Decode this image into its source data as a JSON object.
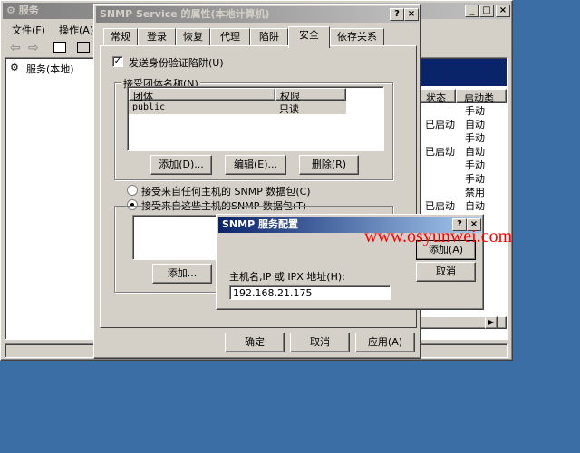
{
  "services_window": {
    "title": "服务",
    "menu": [
      "文件(F)",
      "操作(A)"
    ],
    "tree_item": "服务(本地)",
    "columns": [
      "状态",
      "启动类"
    ],
    "status_rows": [
      {
        "status": "",
        "startup": "手动"
      },
      {
        "status": "已启动",
        "startup": "自动"
      },
      {
        "status": "",
        "startup": "手动"
      },
      {
        "status": "已启动",
        "startup": "自动"
      },
      {
        "status": "",
        "startup": "手动"
      },
      {
        "status": "",
        "startup": "手动"
      },
      {
        "status": "",
        "startup": "禁用"
      },
      {
        "status": "已启动",
        "startup": "自动"
      }
    ]
  },
  "props_dialog": {
    "title": "SNMP Service 的属性(本地计算机)",
    "tabs": [
      "常规",
      "登录",
      "恢复",
      "代理",
      "陷阱",
      "安全",
      "依存关系"
    ],
    "active_tab": "安全",
    "send_trap_label": "发送身份验证陷阱(U)",
    "community_group_label": "接受团体名称(N)",
    "community_columns": [
      "团体",
      "权限"
    ],
    "community_rows": [
      {
        "name": "public",
        "rights": "只读"
      }
    ],
    "add_btn": "添加(D)...",
    "edit_btn": "编辑(E)...",
    "delete_btn": "删除(R)",
    "radio_any": "接受来自任何主机的 SNMP 数据包(C)",
    "radio_these": "接受来自这些主机的SNMP 数据包(T)",
    "hosts_add_btn": "添加...",
    "ok_btn": "确定",
    "cancel_btn": "取消",
    "apply_btn": "应用(A)"
  },
  "config_dialog": {
    "title": "SNMP 服务配置",
    "host_label": "主机名,IP 或 IPX 地址(H):",
    "host_value": "192.168.21.175",
    "add_btn": "添加(A)",
    "cancel_btn": "取消"
  },
  "watermark": "www.osyunwei.com"
}
